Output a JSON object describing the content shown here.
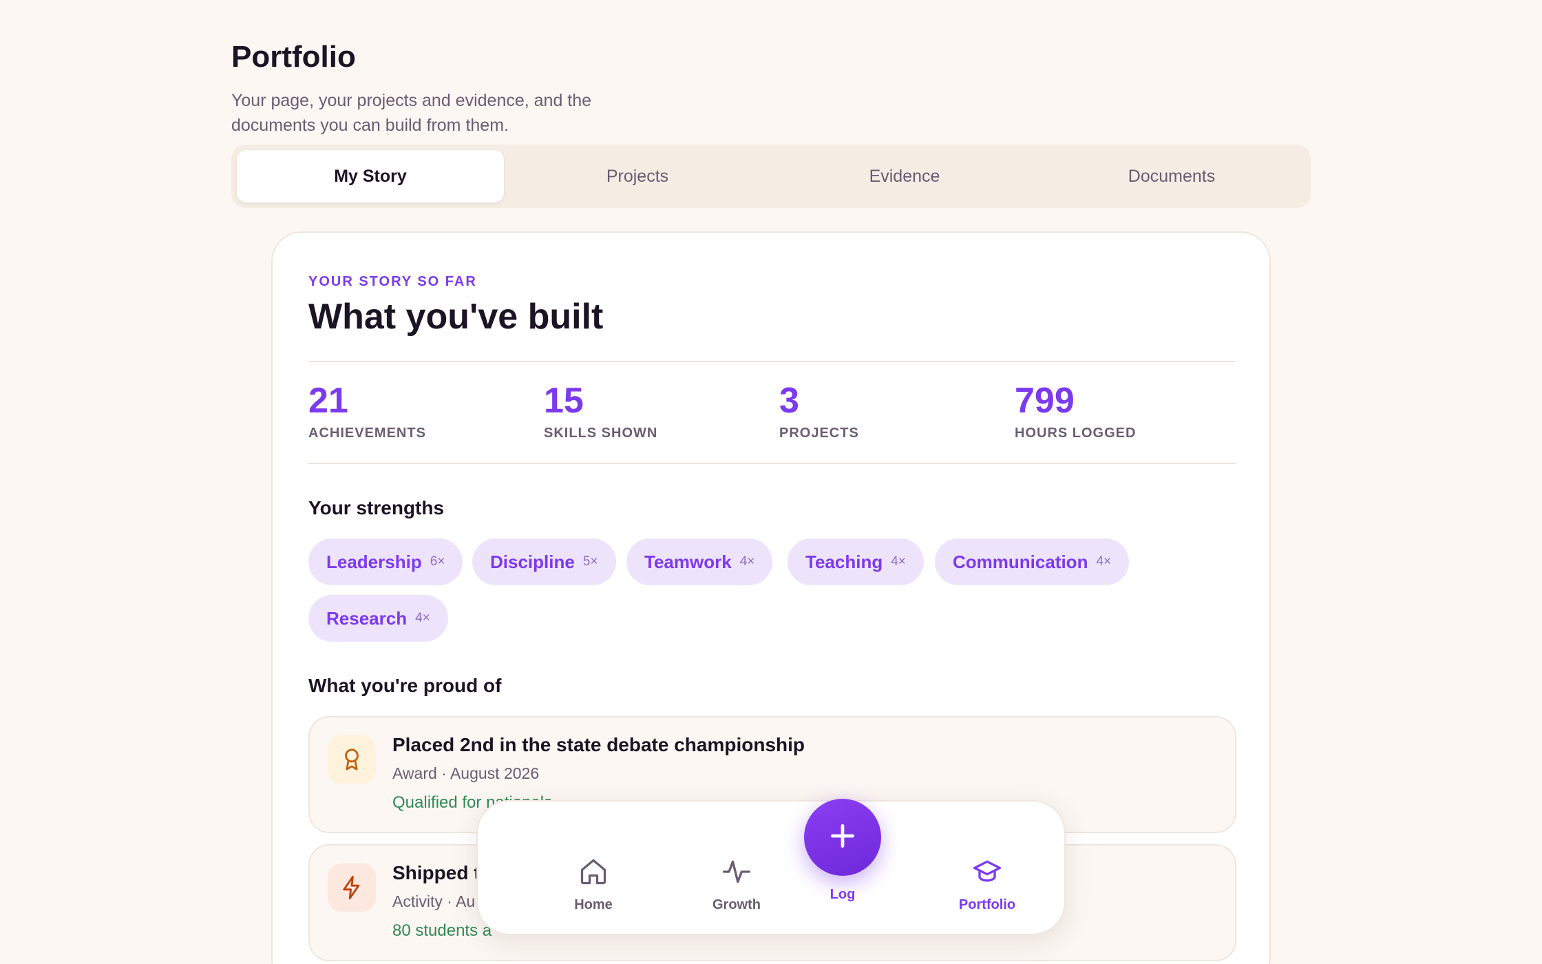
{
  "header": {
    "title": "Portfolio",
    "subtitle": "Your page, your projects and evidence, and the documents you can build from them."
  },
  "tabs": [
    {
      "label": "My Story",
      "active": true
    },
    {
      "label": "Projects",
      "active": false
    },
    {
      "label": "Evidence",
      "active": false
    },
    {
      "label": "Documents",
      "active": false
    }
  ],
  "story": {
    "eyebrow": "YOUR STORY SO FAR",
    "title": "What you've built",
    "stats": [
      {
        "value": "21",
        "label": "ACHIEVEMENTS"
      },
      {
        "value": "15",
        "label": "SKILLS SHOWN"
      },
      {
        "value": "3",
        "label": "PROJECTS"
      },
      {
        "value": "799",
        "label": "HOURS LOGGED"
      }
    ],
    "strengths_heading": "Your strengths",
    "strengths": [
      {
        "name": "Leadership",
        "count": "6×"
      },
      {
        "name": "Discipline",
        "count": "5×"
      },
      {
        "name": "Teamwork",
        "count": "4×"
      },
      {
        "name": "Teaching",
        "count": "4×"
      },
      {
        "name": "Communication",
        "count": "4×"
      },
      {
        "name": "Research",
        "count": "4×"
      }
    ],
    "proud_heading": "What you're proud of",
    "achievements": [
      {
        "icon": "award-ribbon-icon",
        "title": "Placed 2nd in the state debate championship",
        "meta": "Award · August 2026",
        "note": "Qualified for nationals"
      },
      {
        "icon": "lightning-icon",
        "title": "Shipped t",
        "meta": "Activity · Au",
        "note": "80 students a"
      }
    ]
  },
  "nav": {
    "items": [
      {
        "label": "Home",
        "icon": "home-icon"
      },
      {
        "label": "Growth",
        "icon": "activity-icon"
      },
      {
        "label": "Log",
        "icon": "plus-icon"
      },
      {
        "label": "Portfolio",
        "icon": "graduation-cap-icon"
      }
    ]
  },
  "colors": {
    "accent": "#7c3aed",
    "background": "#fcf7f3",
    "chip_bg": "#ede4fc",
    "success": "#2f8a55",
    "award_icon_bg": "#fdf3dc",
    "bolt_icon_bg": "#fde8df"
  }
}
